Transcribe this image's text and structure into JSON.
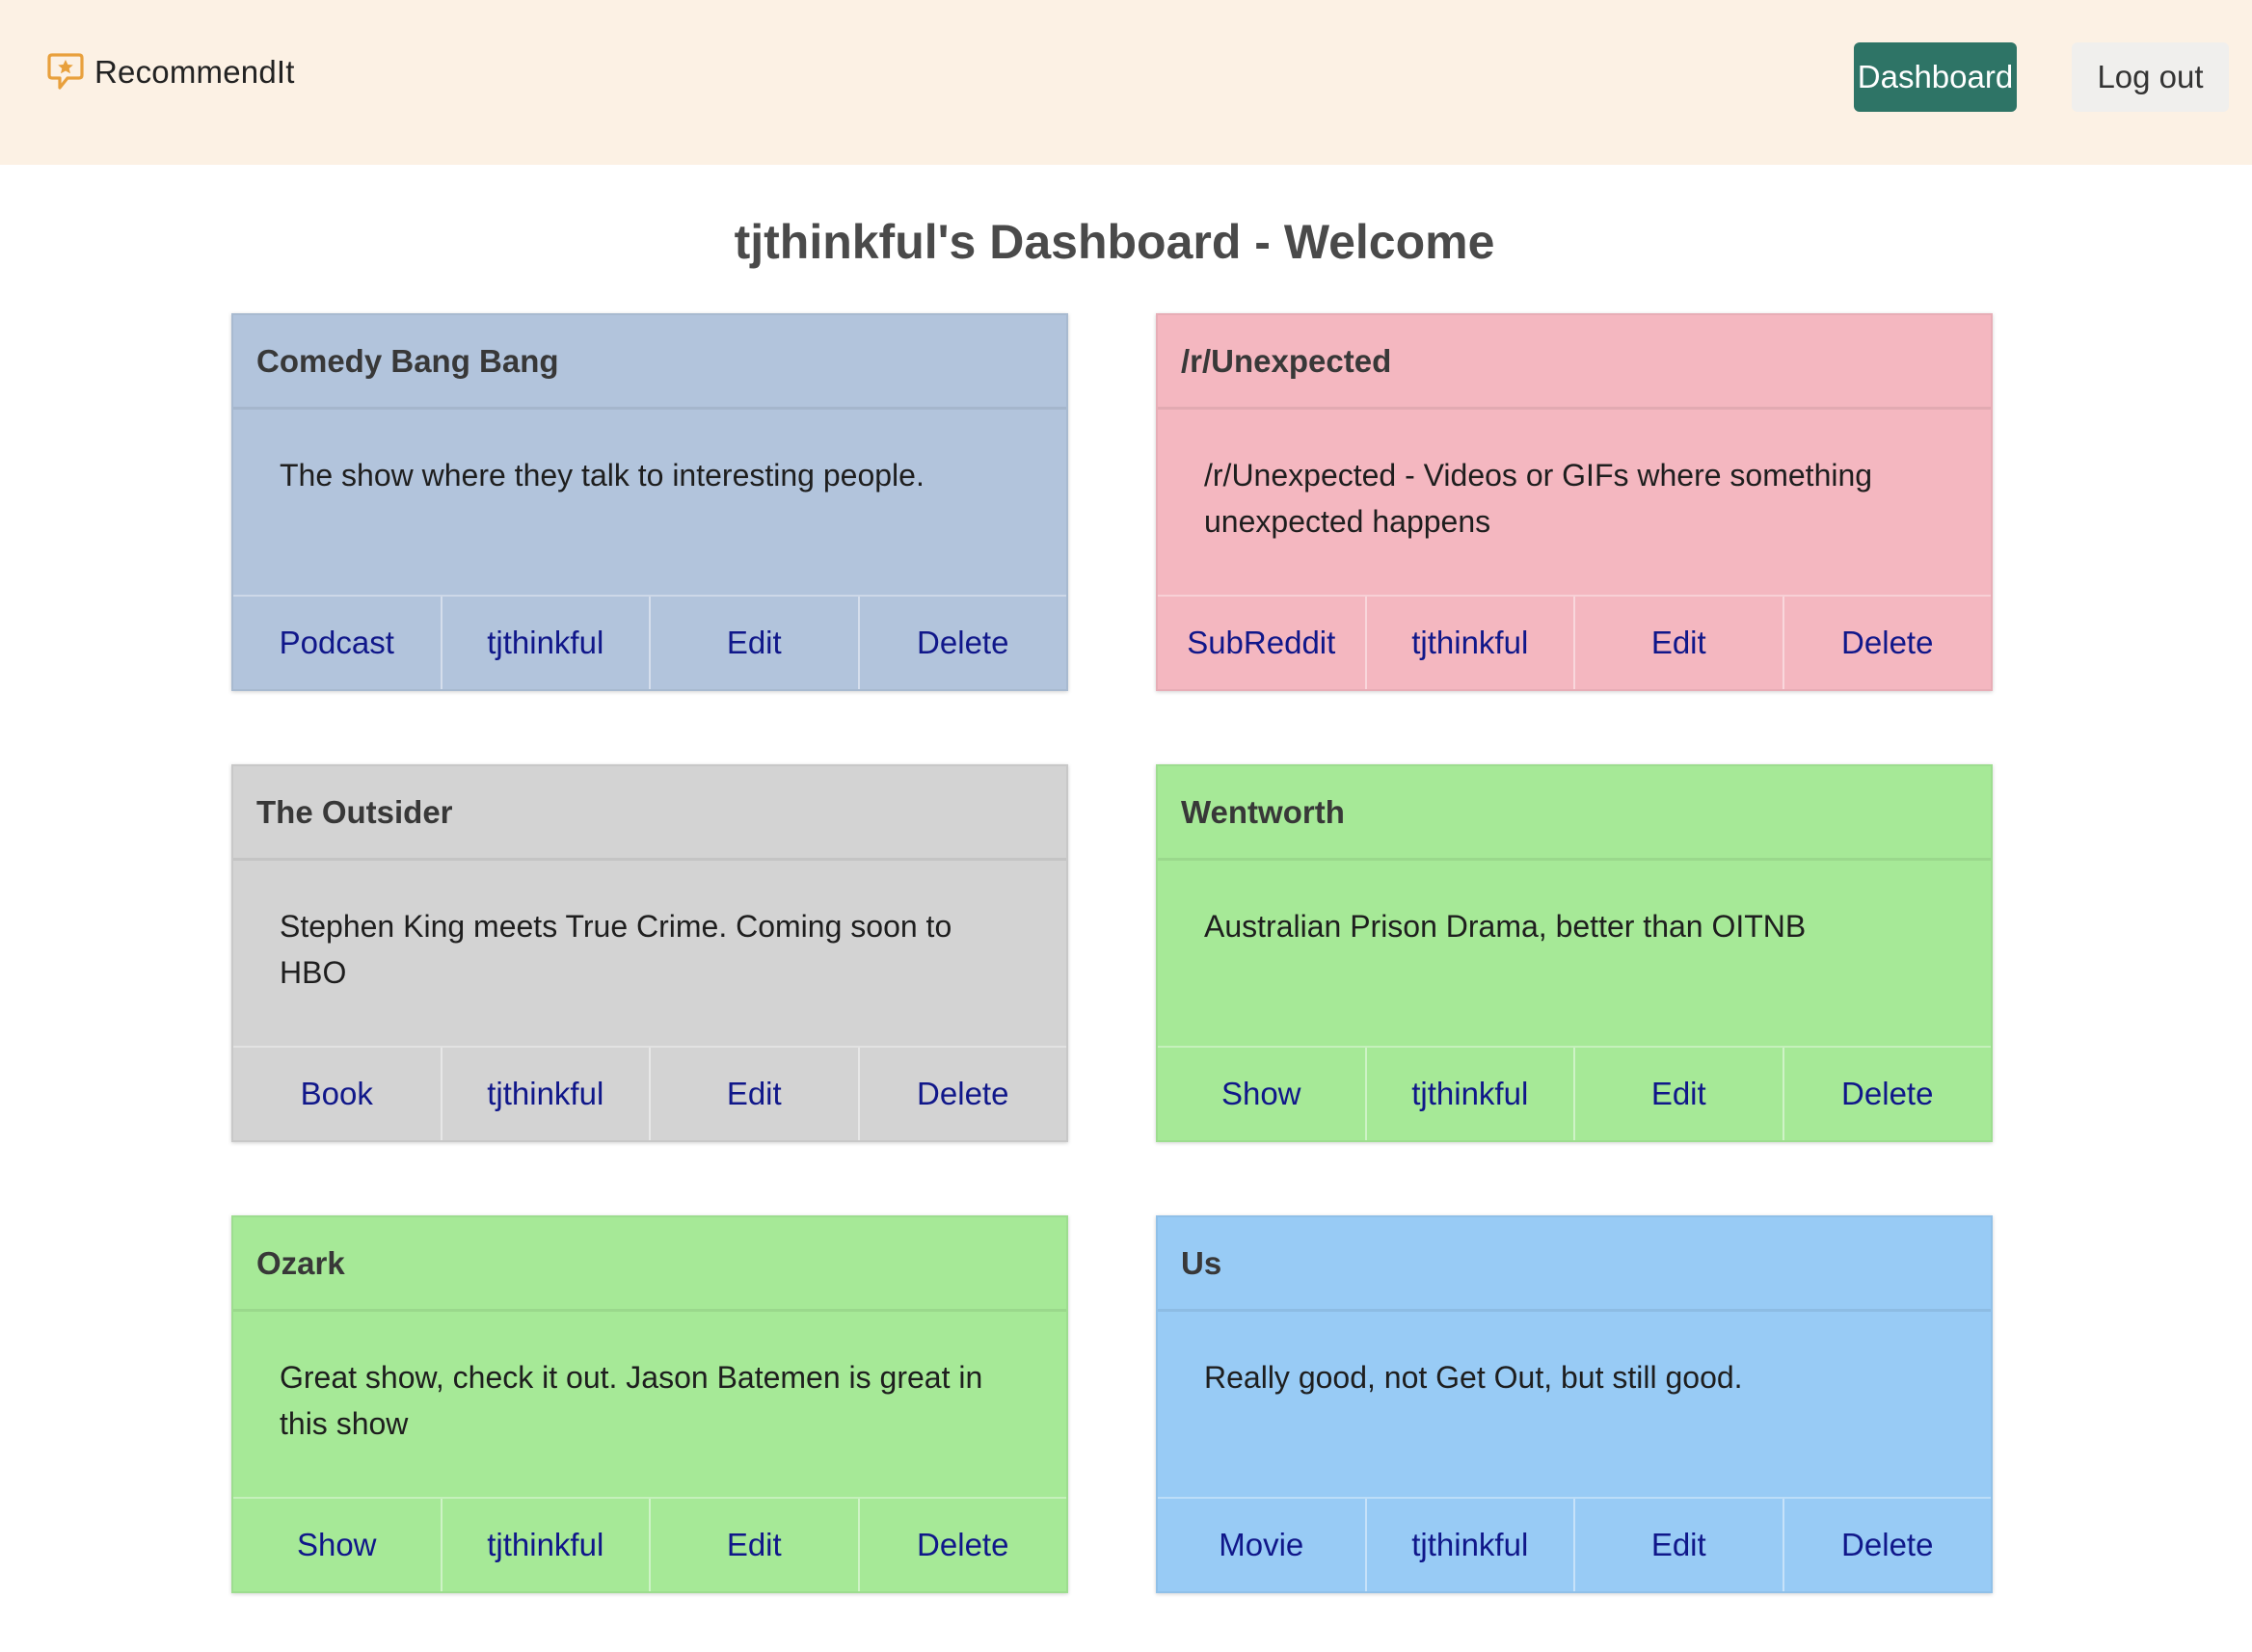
{
  "navbar": {
    "brand_name": "RecommendIt",
    "brand_icon": "star-speech-bubble-icon",
    "dashboard_label": "Dashboard",
    "logout_label": "Log out",
    "colors": {
      "background": "#fcf1e4",
      "dashboard_button": "#2e7466",
      "logout_button": "#f0efed",
      "brand_icon": "#e8a03c"
    }
  },
  "page": {
    "title": "tjthinkful's Dashboard - Welcome"
  },
  "cards": [
    {
      "title": "Comedy Bang Bang",
      "description": "The show where they talk to interesting people.",
      "category": "Podcast",
      "author": "tjthinkful",
      "edit_label": "Edit",
      "delete_label": "Delete",
      "color": "#b2c4dc"
    },
    {
      "title": "/r/Unexpected",
      "description": "/r/Unexpected - Videos or GIFs where something unexpected happens",
      "category": "SubReddit",
      "author": "tjthinkful",
      "edit_label": "Edit",
      "delete_label": "Delete",
      "color": "#f4b7c0"
    },
    {
      "title": "The Outsider",
      "description": "Stephen King meets True Crime. Coming soon to HBO",
      "category": "Book",
      "author": "tjthinkful",
      "edit_label": "Edit",
      "delete_label": "Delete",
      "color": "#d3d3d3"
    },
    {
      "title": "Wentworth",
      "description": "Australian Prison Drama, better than OITNB",
      "category": "Show",
      "author": "tjthinkful",
      "edit_label": "Edit",
      "delete_label": "Delete",
      "color": "#a6e997"
    },
    {
      "title": "Ozark",
      "description": "Great show, check it out. Jason Batemen is great in this show",
      "category": "Show",
      "author": "tjthinkful",
      "edit_label": "Edit",
      "delete_label": "Delete",
      "color": "#a6e997"
    },
    {
      "title": "Us",
      "description": "Really good, not Get Out, but still good.",
      "category": "Movie",
      "author": "tjthinkful",
      "edit_label": "Edit",
      "delete_label": "Delete",
      "color": "#98cbf5"
    }
  ],
  "colors": {
    "link": "#10178a",
    "title_text": "#4a4a4a"
  }
}
